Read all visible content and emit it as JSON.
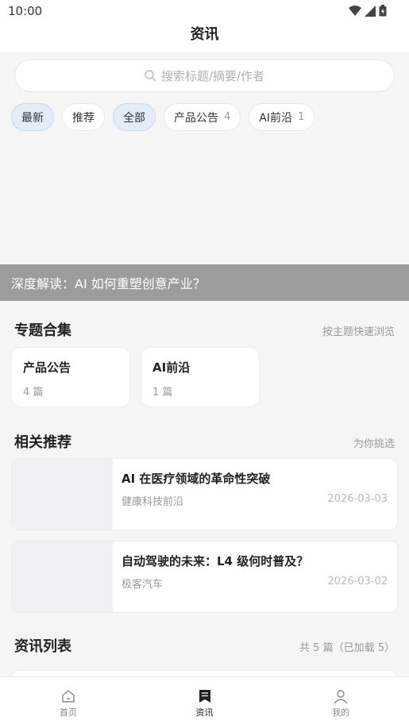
{
  "status": {
    "time": "10:00"
  },
  "header": {
    "title": "资讯"
  },
  "search": {
    "placeholder": "搜索标题/摘要/作者"
  },
  "chips": [
    {
      "label": "最新",
      "count": "",
      "active": true
    },
    {
      "label": "推荐",
      "count": "",
      "active": false
    },
    {
      "label": "全部",
      "count": "",
      "active": true
    },
    {
      "label": "产品公告",
      "count": "4",
      "active": false
    },
    {
      "label": "AI前沿",
      "count": "1",
      "active": false
    }
  ],
  "banner": {
    "caption": "深度解读：AI 如何重塑创意产业？"
  },
  "topics": {
    "title": "专题合集",
    "aside": "按主题快速浏览",
    "items": [
      {
        "name": "产品公告",
        "count": "4 篇"
      },
      {
        "name": "AI前沿",
        "count": "1 篇"
      }
    ]
  },
  "recommend": {
    "title": "相关推荐",
    "aside": "为你挑选",
    "items": [
      {
        "title": "AI 在医疗领域的革命性突破",
        "source": "健康科技前沿",
        "date": "2026-03-03"
      },
      {
        "title": "自动驾驶的未来：L4 级何时普及？",
        "source": "极客汽车",
        "date": "2026-03-02"
      }
    ]
  },
  "list": {
    "title": "资讯列表",
    "aside": "共 5 篇（已加载 5）"
  },
  "tabbar": {
    "items": [
      {
        "label": "首页",
        "icon": "home-icon",
        "active": false
      },
      {
        "label": "资讯",
        "icon": "bookmark-icon",
        "active": true
      },
      {
        "label": "我的",
        "icon": "user-icon",
        "active": false
      }
    ]
  },
  "colors": {
    "accent_chip_bg": "#e4ecf8",
    "banner_caption_bg": "#9c9c9c"
  }
}
